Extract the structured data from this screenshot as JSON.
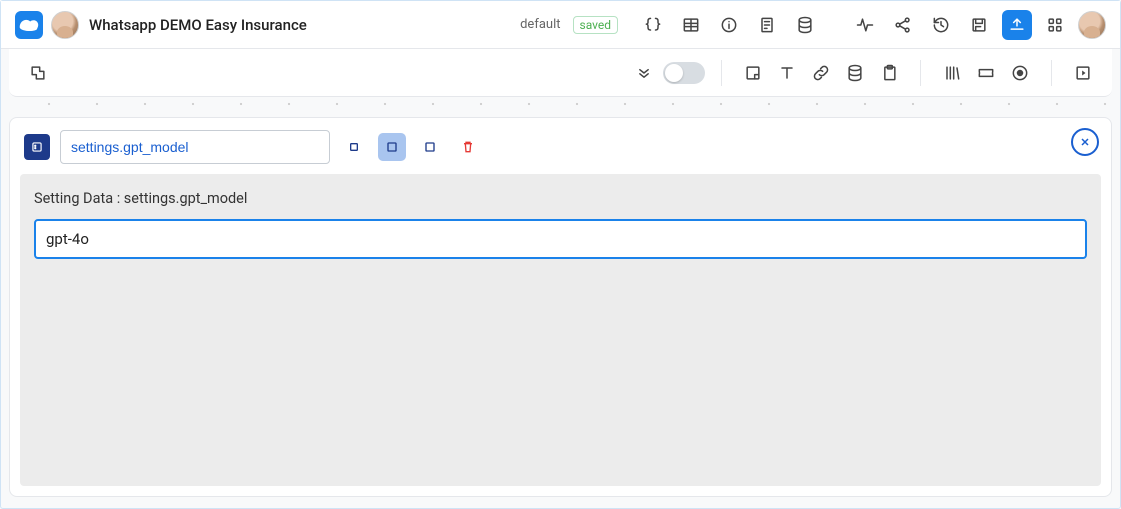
{
  "header": {
    "project_title": "Whatsapp DEMO Easy Insurance",
    "env_label": "default",
    "saved_label": "saved"
  },
  "node": {
    "name_value": "settings.gpt_model",
    "body_label_prefix": "Setting Data : ",
    "body_label_key": "settings.gpt_model",
    "value": "gpt-4o"
  }
}
